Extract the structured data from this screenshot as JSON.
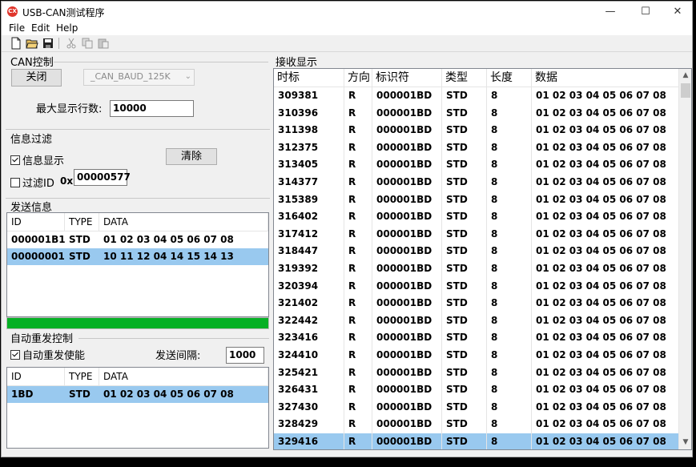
{
  "window": {
    "title": "USB-CAN测试程序",
    "icon": "app-logo-icon"
  },
  "menu": [
    "File",
    "Edit",
    "Help"
  ],
  "toolbar": {
    "icons": [
      "new-file-icon",
      "open-folder-icon",
      "save-icon",
      "cut-icon",
      "copy-icon",
      "paste-icon"
    ]
  },
  "can_control": {
    "label": "CAN控制",
    "close_button": "关闭",
    "baud_value": "_CAN_BAUD_125K",
    "max_rows_label": "最大显示行数:",
    "max_rows_value": "10000"
  },
  "filter": {
    "label": "信息过滤",
    "show_label": "信息显示",
    "show_checked": true,
    "clear_button": "清除",
    "filter_id_label": "过滤ID",
    "filter_id_checked": false,
    "hex_prefix": "0x",
    "filter_id_value": "00000577"
  },
  "send": {
    "label": "发送信息",
    "columns": [
      "ID",
      "TYPE",
      "DATA"
    ],
    "rows": [
      {
        "id": "000001B1",
        "type": "STD",
        "data": "01 02 03 04 05 06 07 08",
        "selected": false
      },
      {
        "id": "00000001",
        "type": "STD",
        "data": "10 11 12 04 14 15 14 13",
        "selected": true
      }
    ],
    "progress": 1.0
  },
  "auto_resend": {
    "label": "自动重发控制",
    "enable_label": "自动重发使能",
    "enable_checked": true,
    "interval_label": "发送间隔:",
    "interval_value": "1000",
    "columns": [
      "ID",
      "TYPE",
      "DATA"
    ],
    "rows": [
      {
        "id": "1BD",
        "type": "STD",
        "data": "01 02 03 04 05 06 07 08",
        "selected": true
      }
    ]
  },
  "receive": {
    "label": "接收显示",
    "columns": [
      "时标",
      "方向",
      "标识符",
      "类型",
      "长度",
      "数据"
    ],
    "rows": [
      {
        "time": "309381",
        "dir": "R",
        "id": "000001BD",
        "type": "STD",
        "len": "8",
        "data": "01 02 03 04 05 06 07 08"
      },
      {
        "time": "310396",
        "dir": "R",
        "id": "000001BD",
        "type": "STD",
        "len": "8",
        "data": "01 02 03 04 05 06 07 08"
      },
      {
        "time": "311398",
        "dir": "R",
        "id": "000001BD",
        "type": "STD",
        "len": "8",
        "data": "01 02 03 04 05 06 07 08"
      },
      {
        "time": "312375",
        "dir": "R",
        "id": "000001BD",
        "type": "STD",
        "len": "8",
        "data": "01 02 03 04 05 06 07 08"
      },
      {
        "time": "313405",
        "dir": "R",
        "id": "000001BD",
        "type": "STD",
        "len": "8",
        "data": "01 02 03 04 05 06 07 08"
      },
      {
        "time": "314377",
        "dir": "R",
        "id": "000001BD",
        "type": "STD",
        "len": "8",
        "data": "01 02 03 04 05 06 07 08"
      },
      {
        "time": "315389",
        "dir": "R",
        "id": "000001BD",
        "type": "STD",
        "len": "8",
        "data": "01 02 03 04 05 06 07 08"
      },
      {
        "time": "316402",
        "dir": "R",
        "id": "000001BD",
        "type": "STD",
        "len": "8",
        "data": "01 02 03 04 05 06 07 08"
      },
      {
        "time": "317412",
        "dir": "R",
        "id": "000001BD",
        "type": "STD",
        "len": "8",
        "data": "01 02 03 04 05 06 07 08"
      },
      {
        "time": "318447",
        "dir": "R",
        "id": "000001BD",
        "type": "STD",
        "len": "8",
        "data": "01 02 03 04 05 06 07 08"
      },
      {
        "time": "319392",
        "dir": "R",
        "id": "000001BD",
        "type": "STD",
        "len": "8",
        "data": "01 02 03 04 05 06 07 08"
      },
      {
        "time": "320394",
        "dir": "R",
        "id": "000001BD",
        "type": "STD",
        "len": "8",
        "data": "01 02 03 04 05 06 07 08"
      },
      {
        "time": "321402",
        "dir": "R",
        "id": "000001BD",
        "type": "STD",
        "len": "8",
        "data": "01 02 03 04 05 06 07 08"
      },
      {
        "time": "322442",
        "dir": "R",
        "id": "000001BD",
        "type": "STD",
        "len": "8",
        "data": "01 02 03 04 05 06 07 08"
      },
      {
        "time": "323416",
        "dir": "R",
        "id": "000001BD",
        "type": "STD",
        "len": "8",
        "data": "01 02 03 04 05 06 07 08"
      },
      {
        "time": "324410",
        "dir": "R",
        "id": "000001BD",
        "type": "STD",
        "len": "8",
        "data": "01 02 03 04 05 06 07 08"
      },
      {
        "time": "325421",
        "dir": "R",
        "id": "000001BD",
        "type": "STD",
        "len": "8",
        "data": "01 02 03 04 05 06 07 08"
      },
      {
        "time": "326431",
        "dir": "R",
        "id": "000001BD",
        "type": "STD",
        "len": "8",
        "data": "01 02 03 04 05 06 07 08"
      },
      {
        "time": "327430",
        "dir": "R",
        "id": "000001BD",
        "type": "STD",
        "len": "8",
        "data": "01 02 03 04 05 06 07 08"
      },
      {
        "time": "328429",
        "dir": "R",
        "id": "000001BD",
        "type": "STD",
        "len": "8",
        "data": "01 02 03 04 05 06 07 08"
      },
      {
        "time": "329416",
        "dir": "R",
        "id": "000001BD",
        "type": "STD",
        "len": "8",
        "data": "01 02 03 04 05 06 07 08",
        "selected": true
      }
    ]
  },
  "colors": {
    "selection": "#99c9ef",
    "progress": "#06b025",
    "app_icon": "#e0362c"
  }
}
